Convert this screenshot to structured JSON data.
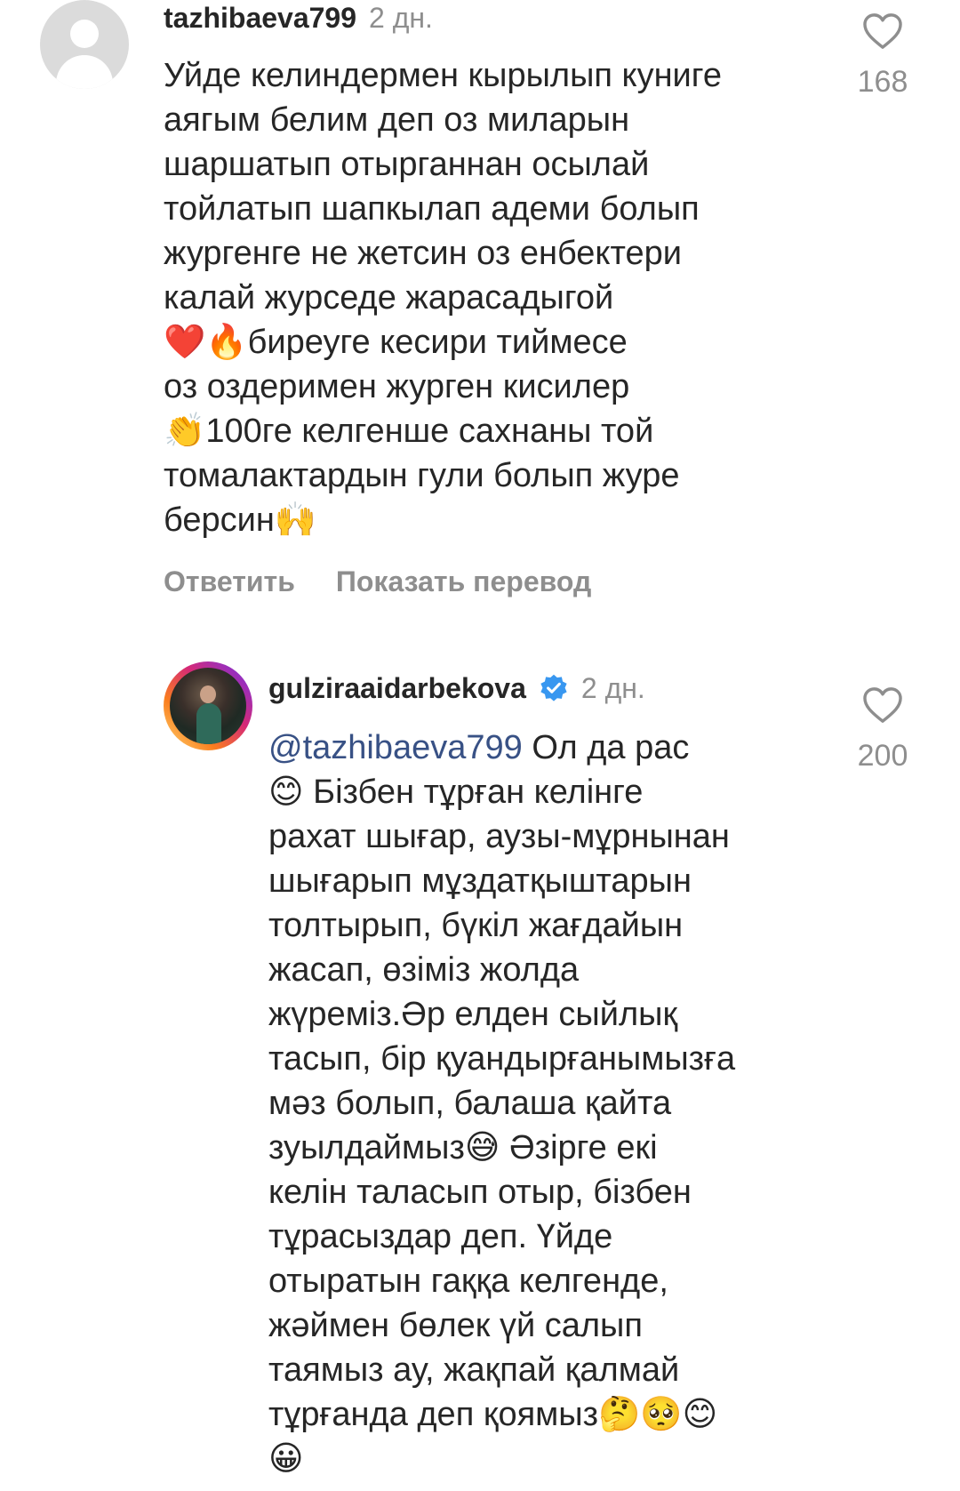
{
  "comments": [
    {
      "username": "tazhibaeva799",
      "time": "2 дн.",
      "likes": "168",
      "avatar_icon": "default-avatar-icon",
      "lines": [
        "Уйде келиндермен кырылып куниге",
        "аягым белим деп оз миларын",
        "шаршатып отырганнан осылай",
        "тойлатып шапкылап адеми болып",
        "жургенге не жетсин оз енбектери",
        "калай журседе жарасадыгой",
        "❤️🔥биреуге кесири тиймесе",
        "оз оздеримен журген кисилер",
        "👏100ге келгенше сахнаны той",
        "томалактардын гули болып журе",
        "берсин🙌"
      ],
      "actions": {
        "reply": "Ответить",
        "translate": "Показать перевод"
      }
    },
    {
      "username": "gulziraaidarbekova",
      "verified": true,
      "time": "2 дн.",
      "likes": "200",
      "mention": "@tazhibaeva799",
      "first_line_rest": " Ол да рас",
      "lines": [
        "😊 Бізбен тұрған келінге",
        "рахат шығар, аузы-мұрнынан",
        "шығарып мұздатқыштарын",
        "толтырып, бүкіл жағдайын",
        "жасап, өзіміз жолда",
        "жүреміз.Әр елден сыйлық",
        "тасып, бір қуандырғанымызға",
        "мәз болып, балаша қайта",
        "зуылдаймыз😅 Әзірге екі",
        "келін таласып отыр, бізбен",
        "тұрасыздар деп. Үйде",
        "отыратын гаққа келгенде,",
        "жәймен бөлек үй салып",
        "таямыз ау, жақпай қалмай",
        "тұрғанда деп қоямыз🤔🥺😊",
        "😀"
      ]
    }
  ],
  "colors": {
    "text": "#262626",
    "secondary": "#8e8e8e",
    "mention": "#385185",
    "verified": "#3897f0"
  }
}
